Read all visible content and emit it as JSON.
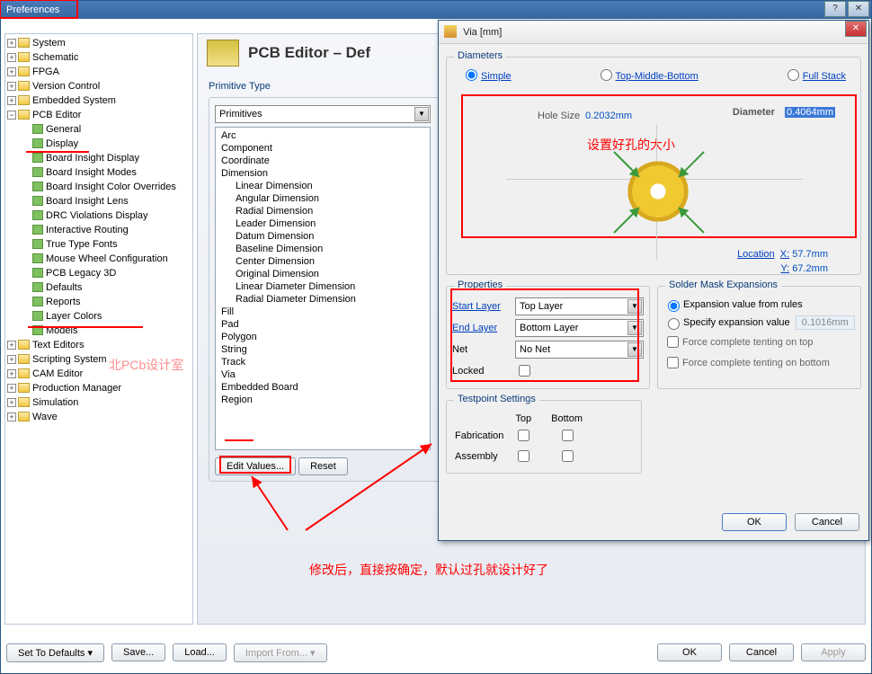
{
  "prefs": {
    "title": "Preferences",
    "tree": {
      "system": "System",
      "schematic": "Schematic",
      "fpga": "FPGA",
      "vc": "Version Control",
      "embed": "Embedded System",
      "pcb": "PCB Editor",
      "pcb_items": [
        "General",
        "Display",
        "Board Insight Display",
        "Board Insight Modes",
        "Board Insight Color Overrides",
        "Board Insight Lens",
        "DRC Violations Display",
        "Interactive Routing",
        "True Type Fonts",
        "Mouse Wheel Configuration",
        "PCB Legacy 3D",
        "Defaults",
        "Reports",
        "Layer Colors",
        "Models"
      ],
      "texted": "Text Editors",
      "script": "Scripting System",
      "cam": "CAM Editor",
      "pm": "Production Manager",
      "sim": "Simulation",
      "wave": "Wave"
    },
    "main_title": "PCB Editor – Def",
    "primitive_type": "Primitive Type",
    "primitives_label": "Primitives",
    "primitives": [
      "Arc",
      "Component",
      "Coordinate",
      "Dimension",
      "    Linear Dimension",
      "    Angular Dimension",
      "    Radial Dimension",
      "    Leader Dimension",
      "    Datum Dimension",
      "    Baseline Dimension",
      "    Center Dimension",
      "    Original Dimension",
      "    Linear Diameter Dimension",
      "    Radial Diameter Dimension",
      "Fill",
      "Pad",
      "Polygon",
      "String",
      "Track",
      "Via",
      "Embedded Board",
      "Region"
    ],
    "edit_values": "Edit Values...",
    "reset": "Reset",
    "footer": {
      "set_def": "Set To Defaults",
      "save": "Save...",
      "load": "Load...",
      "import": "Import From...",
      "ok": "OK",
      "cancel": "Cancel",
      "apply": "Apply"
    }
  },
  "via": {
    "title": "Via [mm]",
    "diameters": "Diameters",
    "simple": "Simple",
    "tmb": "Top-Middle-Bottom",
    "fullstack": "Full Stack",
    "hole_size": "Hole Size",
    "hole_size_val": "0.2032mm",
    "diameter": "Diameter",
    "diameter_val": "0.4064mm",
    "location": "Location",
    "x": "X:",
    "x_val": "57.7mm",
    "y": "Y:",
    "y_val": "67.2mm",
    "properties": "Properties",
    "start_layer": "Start Layer",
    "start_layer_val": "Top Layer",
    "end_layer": "End Layer",
    "end_layer_val": "Bottom Layer",
    "net": "Net",
    "net_val": "No Net",
    "locked": "Locked",
    "solder": "Solder Mask Expansions",
    "exp_rules": "Expansion value from rules",
    "spec_exp": "Specify expansion value",
    "spec_exp_val": "0.1016mm",
    "tent_top": "Force complete tenting on top",
    "tent_bot": "Force complete tenting on bottom",
    "testpoint": "Testpoint Settings",
    "top": "Top",
    "bottom": "Bottom",
    "fab": "Fabrication",
    "assy": "Assembly",
    "ok": "OK",
    "cancel": "Cancel"
  },
  "annot": {
    "hole_size_cn": "设置好孔的大小",
    "bottom_cn": "修改后，直接按确定，默认过孔就设计好了",
    "watermark": "北PCb设计室"
  }
}
